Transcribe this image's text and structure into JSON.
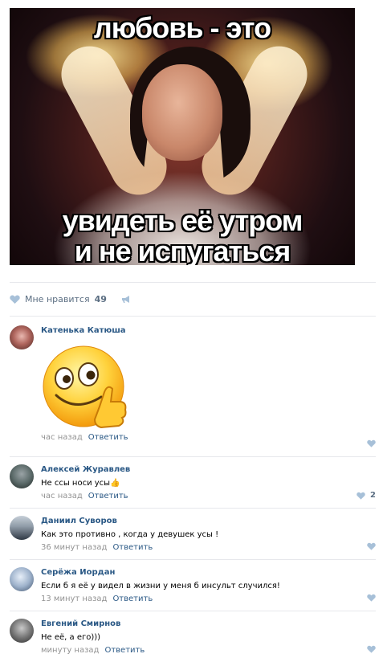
{
  "post": {
    "meme_top": "любовь - это",
    "meme_bottom_line1": "увидеть её утром",
    "meme_bottom_line2": "и не испугаться",
    "likes_label": "Мне нравится",
    "likes_count": "49"
  },
  "comments": [
    {
      "author": "Катенька Катюша",
      "text": "",
      "sticker": "thumbs-up-smiley-sticker",
      "time": "час назад",
      "reply": "Ответить",
      "likes": ""
    },
    {
      "author": "Алексей Журавлев",
      "text": "Не ссы носи усы",
      "emoji": "👍",
      "time": "час назад",
      "reply": "Ответить",
      "likes": "2"
    },
    {
      "author": "Даниил Суворов",
      "text": "Как это противно , когда у девушек усы !",
      "time": "36 минут назад",
      "reply": "Ответить",
      "likes": ""
    },
    {
      "author": "Серёжа Иордан",
      "text": "Если б я её у видел в жизни у меня б инсульт случился!",
      "time": "13 минут назад",
      "reply": "Ответить",
      "likes": ""
    },
    {
      "author": "Евгений Смирнов",
      "text": "Не её, а его)))",
      "time": "минуту назад",
      "reply": "Ответить",
      "likes": ""
    }
  ],
  "colors": {
    "link": "#2a5885",
    "muted": "#939393",
    "like_icon": "#a7c0d8",
    "divider": "#e7e8ec"
  }
}
